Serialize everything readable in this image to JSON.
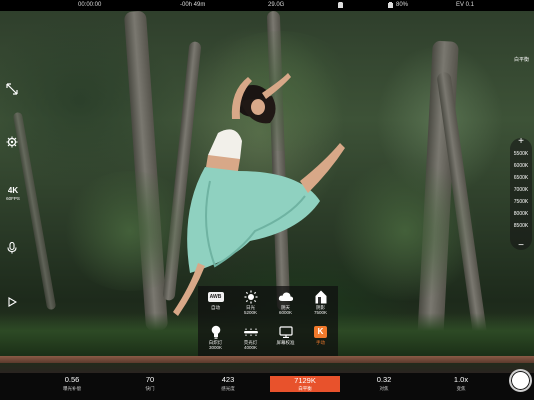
{
  "status_bar": {
    "timecode": "00:00:00",
    "remaining": "-00h 49m",
    "storage": "29.0G",
    "battery": "80%",
    "ev": "EV 0.1"
  },
  "left_controls": {
    "resolution": "4K",
    "frame_rate": "60FPS"
  },
  "white_balance": {
    "title": "白平衡",
    "scale": [
      "5500K",
      "6000K",
      "6500K",
      "7000K",
      "7500K",
      "8000K",
      "8500K"
    ],
    "presets": [
      {
        "label": "自动",
        "sub": "",
        "icon": "awb-icon"
      },
      {
        "label": "日光",
        "sub": "5200K",
        "icon": "sun-icon"
      },
      {
        "label": "阴天",
        "sub": "6000K",
        "icon": "cloud-icon"
      },
      {
        "label": "阴影",
        "sub": "7500K",
        "icon": "shade-icon"
      },
      {
        "label": "白炽灯",
        "sub": "3000K",
        "icon": "bulb-icon"
      },
      {
        "label": "荧光灯",
        "sub": "4000K",
        "icon": "fluorescent-icon"
      },
      {
        "label": "屏幕校准",
        "sub": "",
        "icon": "screen-calibrate-icon"
      },
      {
        "label": "手动",
        "sub": "",
        "icon": "k-manual-icon"
      }
    ],
    "active_preset": "手动",
    "accent_color": "#f07a2c"
  },
  "bottom_params": [
    {
      "value": "0.56",
      "name": "曝光补偿"
    },
    {
      "value": "70",
      "name": "快门"
    },
    {
      "value": "423",
      "name": "感光度"
    },
    {
      "value": "7129K",
      "name": "白平衡",
      "active": true
    },
    {
      "value": "0.32",
      "name": "对焦"
    },
    {
      "value": "1.0x",
      "name": "变焦"
    }
  ],
  "colors": {
    "active_param": "#e8522c",
    "record_button": "#ffffff"
  }
}
